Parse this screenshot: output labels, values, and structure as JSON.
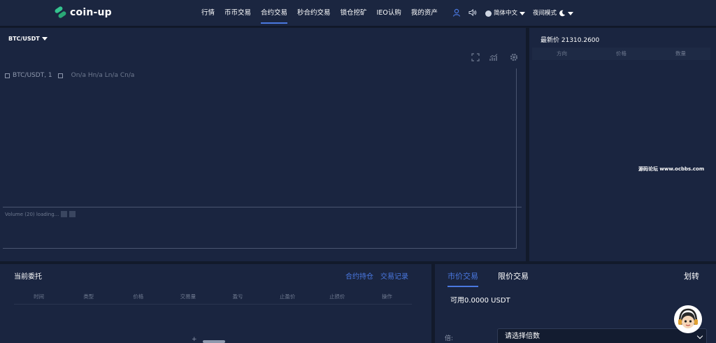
{
  "brand": {
    "logo_text": "coin-up",
    "accent": "#34c38f"
  },
  "nav": {
    "items": [
      "行情",
      "币币交易",
      "合约交易",
      "秒合约交易",
      "锁仓挖矿",
      "IEO认购",
      "我的资产"
    ],
    "active_index": 2,
    "language": "简体中文",
    "theme": "夜间模式",
    "icons": [
      "user-icon",
      "speaker-icon",
      "globe-icon",
      "moon-icon"
    ]
  },
  "chart": {
    "pair": "BTC/USDT",
    "legend_title": "BTC/USDT, 1",
    "legend_values": "On/a Hn/a Ln/a Cn/a",
    "volume_label": "Volume (20) loading...",
    "tools": [
      "fullscreen-icon",
      "indicators-icon",
      "settings-icon"
    ]
  },
  "order_book": {
    "last_price_label": "最新价 21310.2600",
    "columns": [
      "方向",
      "价格",
      "数量"
    ],
    "watermark": "源码论坛 www.ocbbs.com"
  },
  "orders": {
    "title": "当前委托",
    "links": [
      "合约持仓",
      "交易记录"
    ],
    "columns": [
      "时间",
      "类型",
      "价格",
      "交易量",
      "盈亏",
      "止盈价",
      "止损价",
      "操作"
    ]
  },
  "trade": {
    "tabs": [
      "市价交易",
      "限价交易"
    ],
    "active_tab": 0,
    "transfer": "划转",
    "available": "可用0.0000 USDT",
    "leverage_label": "倍:",
    "leverage_placeholder": "请选择倍数"
  },
  "colors": {
    "background": "#121a2b",
    "panel": "#1a2540",
    "nav": "#1b2640",
    "link": "#4a78e0"
  }
}
